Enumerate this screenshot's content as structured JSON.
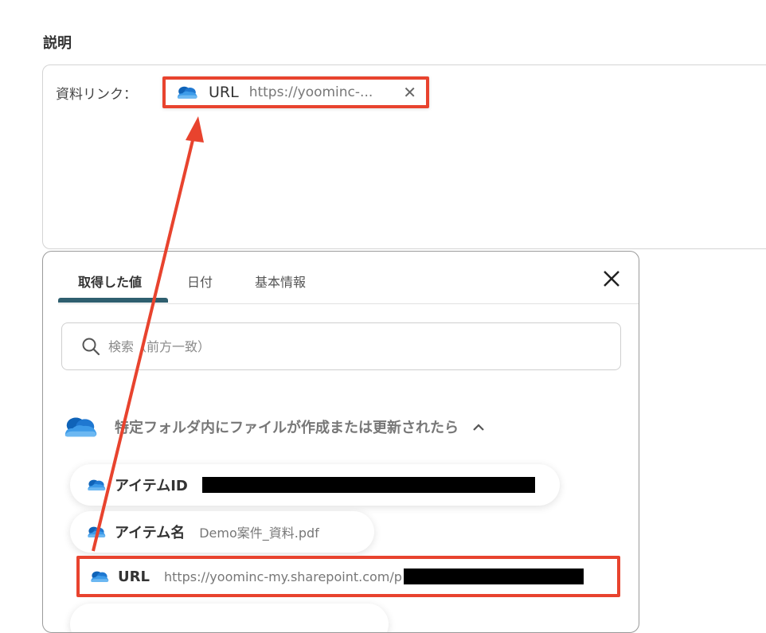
{
  "section": {
    "label": "説明"
  },
  "description": {
    "prefix": "資料リンク：",
    "chip": {
      "label": "URL",
      "value": "https://yoominc-...",
      "close": "✕"
    }
  },
  "panel": {
    "tabs": [
      {
        "label": "取得した値",
        "active": true
      },
      {
        "label": "日付",
        "active": false
      },
      {
        "label": "基本情報",
        "active": false
      }
    ],
    "search": {
      "placeholder": "検索（前方一致）"
    },
    "group": {
      "title": "特定フォルダ内にファイルが作成または更新されたら"
    },
    "items": [
      {
        "label": "アイテムID",
        "value": ""
      },
      {
        "label": "アイテム名",
        "value": "Demo案件_資料.pdf"
      },
      {
        "label": "URL",
        "value": "https://yoominc-my.sharepoint.com/p"
      }
    ]
  },
  "colors": {
    "highlight": "#e8432e",
    "tab_underline": "#2f5f6f",
    "onedrive_blue": "#1f6fc5"
  }
}
